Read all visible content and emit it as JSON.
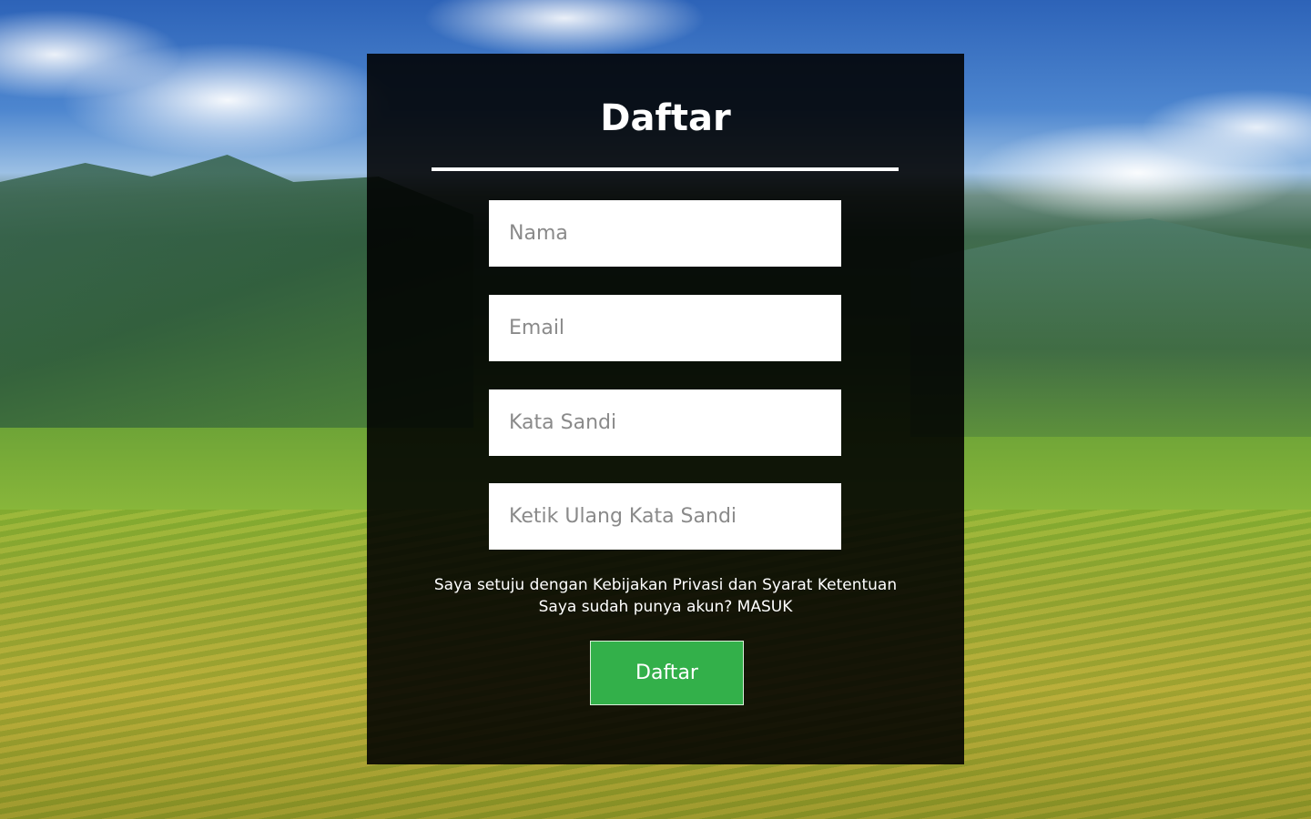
{
  "form": {
    "title": "Daftar",
    "fields": {
      "name_placeholder": "Nama",
      "email_placeholder": "Email",
      "password_placeholder": "Kata Sandi",
      "confirm_password_placeholder": "Ketik Ulang Kata Sandi"
    },
    "terms_text": "Saya setuju dengan Kebijakan Privasi dan Syarat Ketentuan",
    "login_prompt": "Saya sudah punya akun? MASUK",
    "submit_label": "Daftar"
  },
  "colors": {
    "panel_background": "#000000",
    "button": "#33b04a",
    "text": "#ffffff"
  }
}
